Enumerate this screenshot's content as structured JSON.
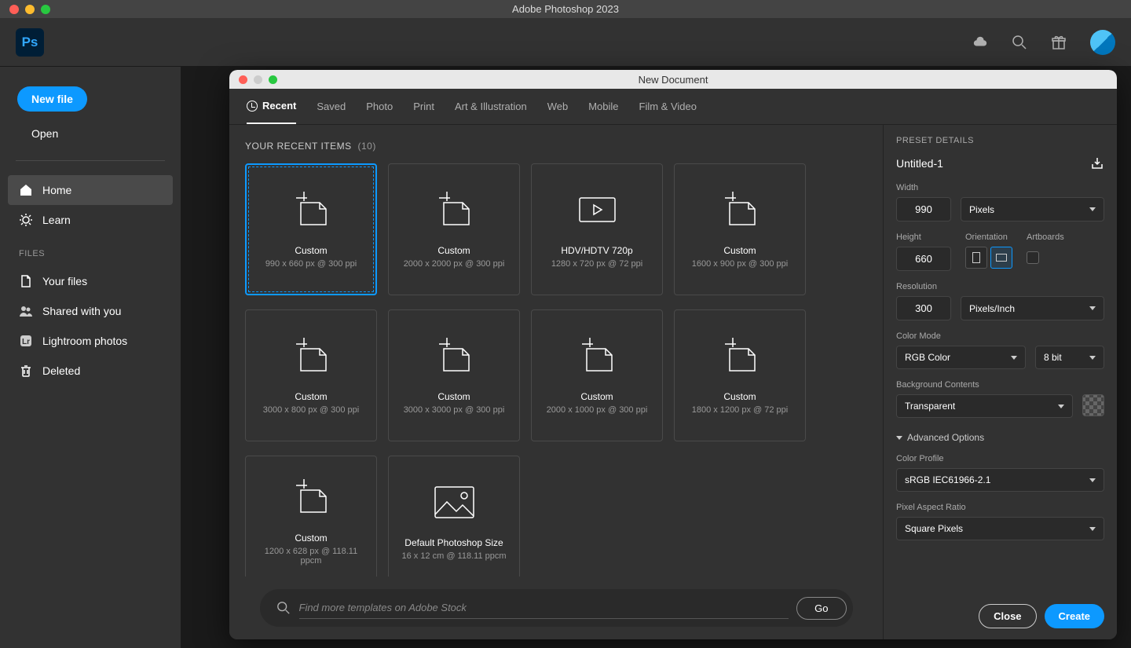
{
  "window": {
    "title": "Adobe Photoshop 2023",
    "logo": "Ps"
  },
  "sidebar": {
    "new_file": "New file",
    "open": "Open",
    "nav": [
      {
        "label": "Home",
        "active": true
      },
      {
        "label": "Learn",
        "active": false
      }
    ],
    "files_label": "FILES",
    "files": [
      {
        "label": "Your files"
      },
      {
        "label": "Shared with you"
      },
      {
        "label": "Lightroom photos"
      },
      {
        "label": "Deleted"
      }
    ]
  },
  "modal": {
    "title": "New Document",
    "tabs": [
      "Recent",
      "Saved",
      "Photo",
      "Print",
      "Art & Illustration",
      "Web",
      "Mobile",
      "Film & Video"
    ],
    "active_tab": 0,
    "recent_label": "YOUR RECENT ITEMS",
    "recent_count": "(10)",
    "presets": [
      {
        "name": "Custom",
        "spec": "990 x 660 px @ 300 ppi",
        "type": "doc",
        "selected": true
      },
      {
        "name": "Custom",
        "spec": "2000 x 2000 px @ 300 ppi",
        "type": "doc"
      },
      {
        "name": "HDV/HDTV 720p",
        "spec": "1280 x 720 px @ 72 ppi",
        "type": "video"
      },
      {
        "name": "Custom",
        "spec": "1600 x 900 px @ 300 ppi",
        "type": "doc"
      },
      {
        "name": "Custom",
        "spec": "3000 x 800 px @ 300 ppi",
        "type": "doc"
      },
      {
        "name": "Custom",
        "spec": "3000 x 3000 px @ 300 ppi",
        "type": "doc"
      },
      {
        "name": "Custom",
        "spec": "2000 x 1000 px @ 300 ppi",
        "type": "doc"
      },
      {
        "name": "Custom",
        "spec": "1800 x 1200 px @ 72 ppi",
        "type": "doc"
      },
      {
        "name": "Custom",
        "spec": "1200 x 628 px @ 118.11 ppcm",
        "type": "doc"
      },
      {
        "name": "Default Photoshop Size",
        "spec": "16 x 12 cm @ 118.11 ppcm",
        "type": "image"
      }
    ],
    "search_placeholder": "Find more templates on Adobe Stock",
    "go": "Go"
  },
  "details": {
    "header": "PRESET DETAILS",
    "name": "Untitled-1",
    "width_label": "Width",
    "width": "990",
    "width_unit": "Pixels",
    "height_label": "Height",
    "height": "660",
    "orientation_label": "Orientation",
    "artboards_label": "Artboards",
    "resolution_label": "Resolution",
    "resolution": "300",
    "resolution_unit": "Pixels/Inch",
    "color_mode_label": "Color Mode",
    "color_mode": "RGB Color",
    "bit_depth": "8 bit",
    "bg_label": "Background Contents",
    "bg": "Transparent",
    "advanced": "Advanced Options",
    "profile_label": "Color Profile",
    "profile": "sRGB IEC61966-2.1",
    "par_label": "Pixel Aspect Ratio",
    "par": "Square Pixels",
    "close": "Close",
    "create": "Create"
  }
}
